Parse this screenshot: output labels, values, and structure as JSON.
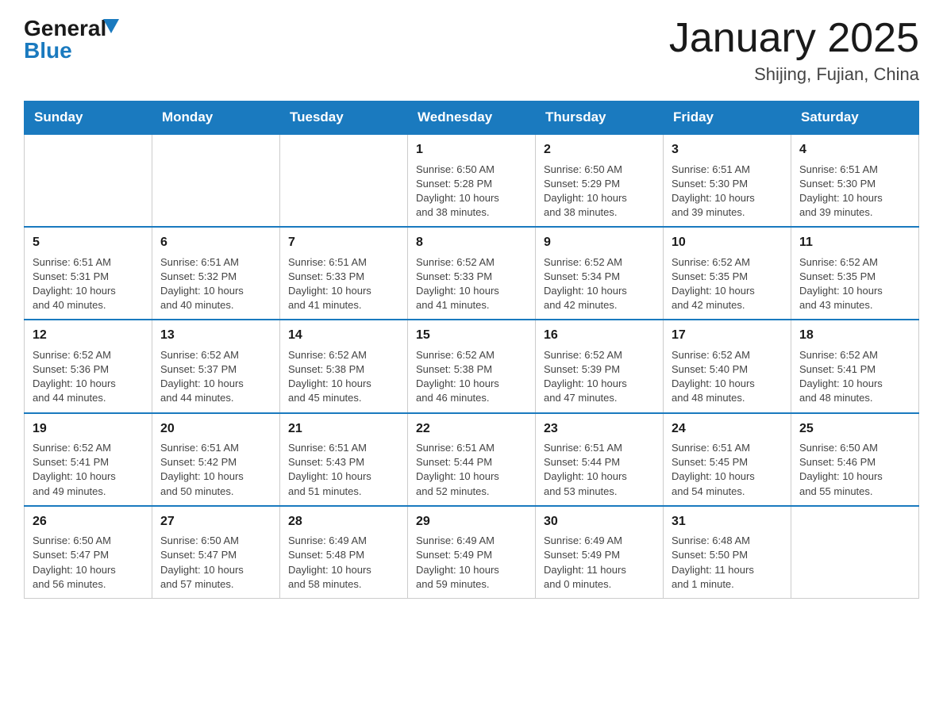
{
  "header": {
    "logo_general": "General",
    "logo_blue": "Blue",
    "month_title": "January 2025",
    "location": "Shijing, Fujian, China"
  },
  "days_of_week": [
    "Sunday",
    "Monday",
    "Tuesday",
    "Wednesday",
    "Thursday",
    "Friday",
    "Saturday"
  ],
  "weeks": [
    [
      {
        "day": "",
        "info": ""
      },
      {
        "day": "",
        "info": ""
      },
      {
        "day": "",
        "info": ""
      },
      {
        "day": "1",
        "info": "Sunrise: 6:50 AM\nSunset: 5:28 PM\nDaylight: 10 hours\nand 38 minutes."
      },
      {
        "day": "2",
        "info": "Sunrise: 6:50 AM\nSunset: 5:29 PM\nDaylight: 10 hours\nand 38 minutes."
      },
      {
        "day": "3",
        "info": "Sunrise: 6:51 AM\nSunset: 5:30 PM\nDaylight: 10 hours\nand 39 minutes."
      },
      {
        "day": "4",
        "info": "Sunrise: 6:51 AM\nSunset: 5:30 PM\nDaylight: 10 hours\nand 39 minutes."
      }
    ],
    [
      {
        "day": "5",
        "info": "Sunrise: 6:51 AM\nSunset: 5:31 PM\nDaylight: 10 hours\nand 40 minutes."
      },
      {
        "day": "6",
        "info": "Sunrise: 6:51 AM\nSunset: 5:32 PM\nDaylight: 10 hours\nand 40 minutes."
      },
      {
        "day": "7",
        "info": "Sunrise: 6:51 AM\nSunset: 5:33 PM\nDaylight: 10 hours\nand 41 minutes."
      },
      {
        "day": "8",
        "info": "Sunrise: 6:52 AM\nSunset: 5:33 PM\nDaylight: 10 hours\nand 41 minutes."
      },
      {
        "day": "9",
        "info": "Sunrise: 6:52 AM\nSunset: 5:34 PM\nDaylight: 10 hours\nand 42 minutes."
      },
      {
        "day": "10",
        "info": "Sunrise: 6:52 AM\nSunset: 5:35 PM\nDaylight: 10 hours\nand 42 minutes."
      },
      {
        "day": "11",
        "info": "Sunrise: 6:52 AM\nSunset: 5:35 PM\nDaylight: 10 hours\nand 43 minutes."
      }
    ],
    [
      {
        "day": "12",
        "info": "Sunrise: 6:52 AM\nSunset: 5:36 PM\nDaylight: 10 hours\nand 44 minutes."
      },
      {
        "day": "13",
        "info": "Sunrise: 6:52 AM\nSunset: 5:37 PM\nDaylight: 10 hours\nand 44 minutes."
      },
      {
        "day": "14",
        "info": "Sunrise: 6:52 AM\nSunset: 5:38 PM\nDaylight: 10 hours\nand 45 minutes."
      },
      {
        "day": "15",
        "info": "Sunrise: 6:52 AM\nSunset: 5:38 PM\nDaylight: 10 hours\nand 46 minutes."
      },
      {
        "day": "16",
        "info": "Sunrise: 6:52 AM\nSunset: 5:39 PM\nDaylight: 10 hours\nand 47 minutes."
      },
      {
        "day": "17",
        "info": "Sunrise: 6:52 AM\nSunset: 5:40 PM\nDaylight: 10 hours\nand 48 minutes."
      },
      {
        "day": "18",
        "info": "Sunrise: 6:52 AM\nSunset: 5:41 PM\nDaylight: 10 hours\nand 48 minutes."
      }
    ],
    [
      {
        "day": "19",
        "info": "Sunrise: 6:52 AM\nSunset: 5:41 PM\nDaylight: 10 hours\nand 49 minutes."
      },
      {
        "day": "20",
        "info": "Sunrise: 6:51 AM\nSunset: 5:42 PM\nDaylight: 10 hours\nand 50 minutes."
      },
      {
        "day": "21",
        "info": "Sunrise: 6:51 AM\nSunset: 5:43 PM\nDaylight: 10 hours\nand 51 minutes."
      },
      {
        "day": "22",
        "info": "Sunrise: 6:51 AM\nSunset: 5:44 PM\nDaylight: 10 hours\nand 52 minutes."
      },
      {
        "day": "23",
        "info": "Sunrise: 6:51 AM\nSunset: 5:44 PM\nDaylight: 10 hours\nand 53 minutes."
      },
      {
        "day": "24",
        "info": "Sunrise: 6:51 AM\nSunset: 5:45 PM\nDaylight: 10 hours\nand 54 minutes."
      },
      {
        "day": "25",
        "info": "Sunrise: 6:50 AM\nSunset: 5:46 PM\nDaylight: 10 hours\nand 55 minutes."
      }
    ],
    [
      {
        "day": "26",
        "info": "Sunrise: 6:50 AM\nSunset: 5:47 PM\nDaylight: 10 hours\nand 56 minutes."
      },
      {
        "day": "27",
        "info": "Sunrise: 6:50 AM\nSunset: 5:47 PM\nDaylight: 10 hours\nand 57 minutes."
      },
      {
        "day": "28",
        "info": "Sunrise: 6:49 AM\nSunset: 5:48 PM\nDaylight: 10 hours\nand 58 minutes."
      },
      {
        "day": "29",
        "info": "Sunrise: 6:49 AM\nSunset: 5:49 PM\nDaylight: 10 hours\nand 59 minutes."
      },
      {
        "day": "30",
        "info": "Sunrise: 6:49 AM\nSunset: 5:49 PM\nDaylight: 11 hours\nand 0 minutes."
      },
      {
        "day": "31",
        "info": "Sunrise: 6:48 AM\nSunset: 5:50 PM\nDaylight: 11 hours\nand 1 minute."
      },
      {
        "day": "",
        "info": ""
      }
    ]
  ]
}
